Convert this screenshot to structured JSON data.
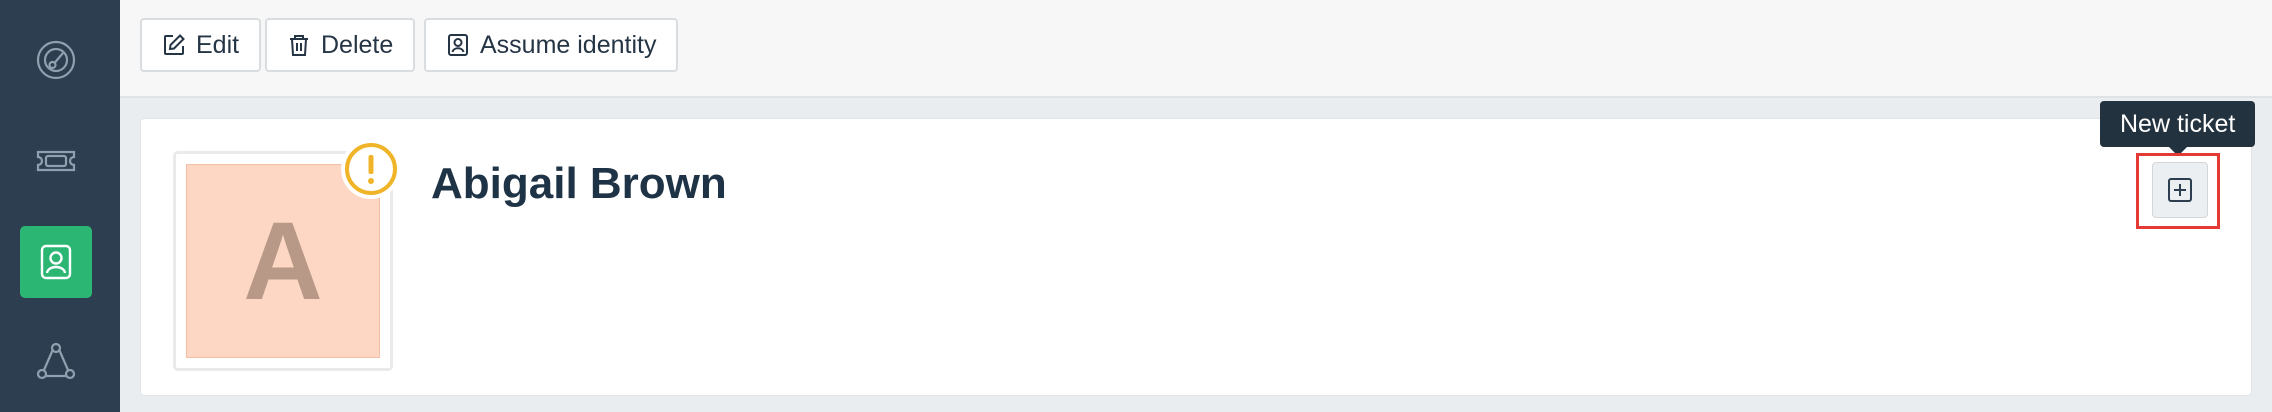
{
  "sidebar": {
    "items": [
      {
        "name": "dashboard",
        "icon": "gauge-icon",
        "active": false
      },
      {
        "name": "tickets",
        "icon": "ticket-icon",
        "active": false
      },
      {
        "name": "customers",
        "icon": "user-icon",
        "active": true
      },
      {
        "name": "organizations",
        "icon": "network-icon",
        "active": false
      }
    ],
    "colors": {
      "background": "#2c3e50",
      "active": "#2bb673"
    }
  },
  "toolbar": {
    "edit_label": "Edit",
    "delete_label": "Delete",
    "assume_identity_label": "Assume identity"
  },
  "profile": {
    "avatar_letter": "A",
    "name": "Abigail Brown",
    "warning_icon": "warning-icon",
    "warning_color": "#f0b429"
  },
  "actions": {
    "new_ticket_tooltip": "New ticket",
    "new_ticket_icon": "plus-square-icon",
    "highlight_color": "#e53935"
  }
}
